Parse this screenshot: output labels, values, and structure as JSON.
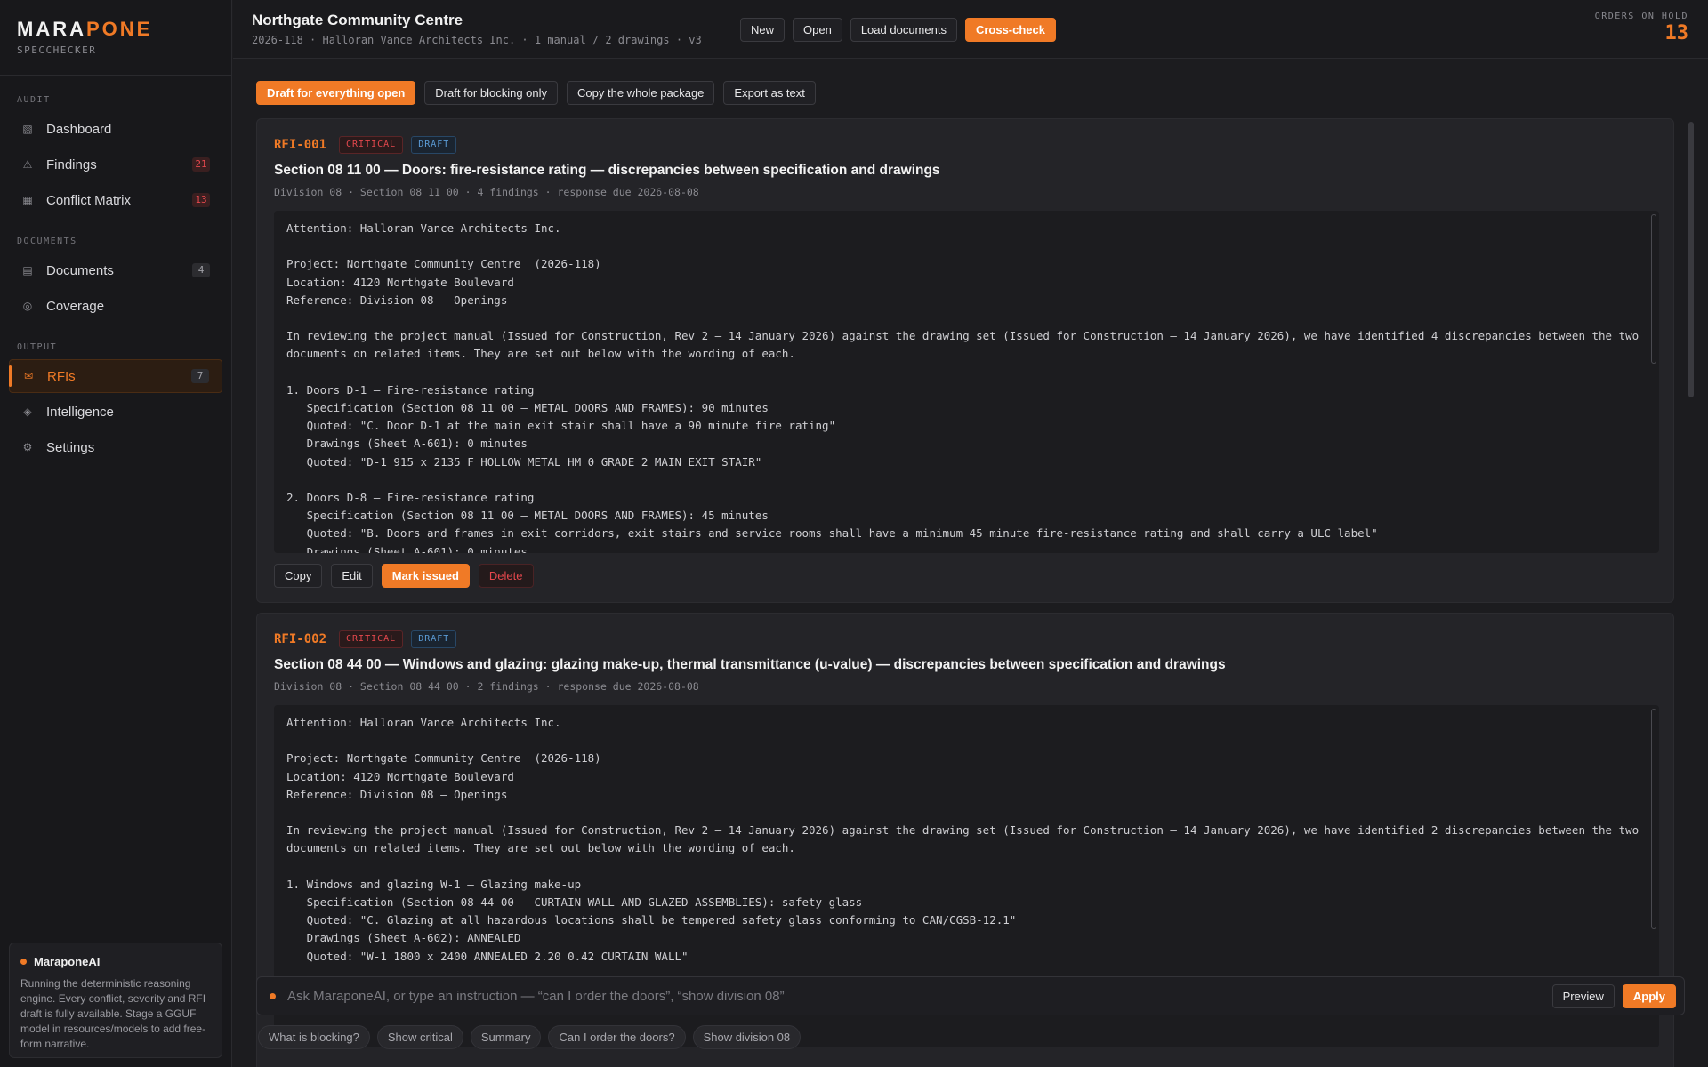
{
  "brand": {
    "name_a": "MARA",
    "name_b": "PONE",
    "sub": "SPECCHECKER"
  },
  "sidebar": {
    "sections": [
      {
        "heading": "AUDIT",
        "items": [
          {
            "icon": "▧",
            "label": "Dashboard",
            "count": ""
          },
          {
            "icon": "⚠",
            "label": "Findings",
            "count": "21"
          },
          {
            "icon": "▦",
            "label": "Conflict Matrix",
            "count": "13"
          }
        ]
      },
      {
        "heading": "DOCUMENTS",
        "items": [
          {
            "icon": "▤",
            "label": "Documents",
            "count": "4"
          },
          {
            "icon": "◎",
            "label": "Coverage",
            "count": ""
          }
        ]
      },
      {
        "heading": "OUTPUT",
        "items": [
          {
            "icon": "✉",
            "label": "RFIs",
            "count": "7"
          },
          {
            "icon": "◈",
            "label": "Intelligence",
            "count": ""
          },
          {
            "icon": "⚙",
            "label": "Settings",
            "count": ""
          }
        ]
      }
    ],
    "ai": {
      "title": "MaraponeAI",
      "text": "Running the deterministic reasoning engine. Every conflict, severity and RFI draft is fully available. Stage a GGUF model in resources/models to add free-form narrative."
    }
  },
  "topbar": {
    "title": "Northgate Community Centre",
    "meta": "2026-118 · Halloran Vance Architects Inc. · 1 manual / 2 drawings · v3",
    "buttons": {
      "new": "New",
      "open": "Open",
      "load": "Load documents",
      "crosscheck": "Cross-check"
    },
    "orders_label": "ORDERS ON HOLD",
    "orders_value": "13"
  },
  "actions": {
    "draft_all": "Draft for everything open",
    "draft_blocking": "Draft for blocking only",
    "copy_package": "Copy the whole package",
    "export": "Export as text"
  },
  "rfis": [
    {
      "id": "RFI-001",
      "severity": "CRITICAL",
      "status": "DRAFT",
      "title": "Section 08 11 00 — Doors: fire-resistance rating — discrepancies between specification and drawings",
      "sub": "Division 08 · Section 08 11 00 · 4 findings · response due 2026-08-08",
      "body": "Attention: Halloran Vance Architects Inc.\n\nProject: Northgate Community Centre  (2026-118)\nLocation: 4120 Northgate Boulevard\nReference: Division 08 — Openings\n\nIn reviewing the project manual (Issued for Construction, Rev 2 — 14 January 2026) against the drawing set (Issued for Construction — 14 January 2026), we have identified 4 discrepancies between the two documents on related items. They are set out below with the wording of each.\n\n1. Doors D-1 — Fire-resistance rating\n   Specification (Section 08 11 00 — METAL DOORS AND FRAMES): 90 minutes\n   Quoted: \"C. Door D-1 at the main exit stair shall have a 90 minute fire rating\"\n   Drawings (Sheet A-601): 0 minutes\n   Quoted: \"D-1 915 x 2135 F HOLLOW METAL HM 0 GRADE 2 MAIN EXIT STAIR\"\n\n2. Doors D-8 — Fire-resistance rating\n   Specification (Section 08 11 00 — METAL DOORS AND FRAMES): 45 minutes\n   Quoted: \"B. Doors and frames in exit corridors, exit stairs and service rooms shall have a minimum 45 minute fire-resistance rating and shall carry a ULC label\"\n   Drawings (Sheet A-601): 0 minutes",
      "buttons": {
        "copy": "Copy",
        "edit": "Edit",
        "issue": "Mark issued",
        "delete": "Delete"
      }
    },
    {
      "id": "RFI-002",
      "severity": "CRITICAL",
      "status": "DRAFT",
      "title": "Section 08 44 00 — Windows and glazing: glazing make-up, thermal transmittance (u-value) — discrepancies between specification and drawings",
      "sub": "Division 08 · Section 08 44 00 · 2 findings · response due 2026-08-08",
      "body": "Attention: Halloran Vance Architects Inc.\n\nProject: Northgate Community Centre  (2026-118)\nLocation: 4120 Northgate Boulevard\nReference: Division 08 — Openings\n\nIn reviewing the project manual (Issued for Construction, Rev 2 — 14 January 2026) against the drawing set (Issued for Construction — 14 January 2026), we have identified 2 discrepancies between the two documents on related items. They are set out below with the wording of each.\n\n1. Windows and glazing W-1 — Glazing make-up\n   Specification (Section 08 44 00 — CURTAIN WALL AND GLAZED ASSEMBLIES): safety glass\n   Quoted: \"C. Glazing at all hazardous locations shall be tempered safety glass conforming to CAN/CGSB-12.1\"\n   Drawings (Sheet A-602): ANNEALED\n   Quoted: \"W-1 1800 x 2400 ANNEALED 2.20 0.42 CURTAIN WALL\""
    }
  ],
  "command": {
    "placeholder": "Ask MaraponeAI, or type an instruction — “can I order the doors”, “show division 08”",
    "preview": "Preview",
    "apply": "Apply"
  },
  "chips": [
    "What is blocking?",
    "Show critical",
    "Summary",
    "Can I order the doors?",
    "Show division 08"
  ],
  "colors": {
    "accent": "#f07a26",
    "critical": "#e5484d",
    "draft": "#5b9bd5",
    "background": "#1c1c1f"
  }
}
